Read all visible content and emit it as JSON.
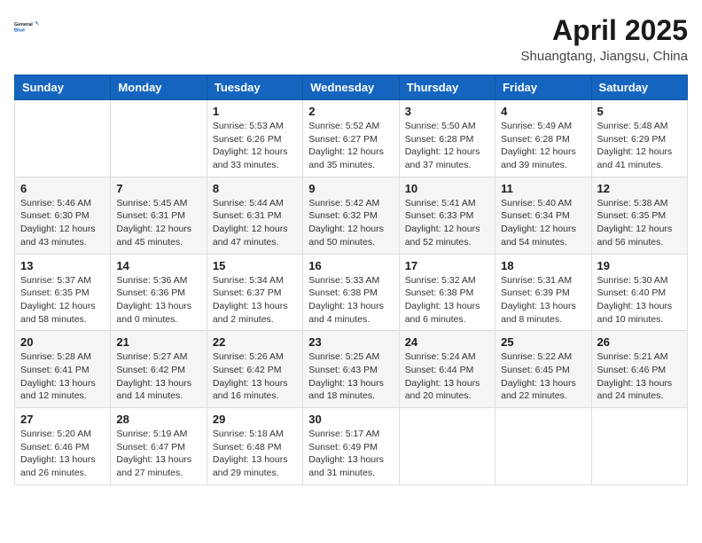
{
  "header": {
    "logo_line1": "General",
    "logo_line2": "Blue",
    "title": "April 2025",
    "subtitle": "Shuangtang, Jiangsu, China"
  },
  "weekdays": [
    "Sunday",
    "Monday",
    "Tuesday",
    "Wednesday",
    "Thursday",
    "Friday",
    "Saturday"
  ],
  "weeks": [
    [
      {
        "day": "",
        "sunrise": "",
        "sunset": "",
        "daylight": ""
      },
      {
        "day": "",
        "sunrise": "",
        "sunset": "",
        "daylight": ""
      },
      {
        "day": "1",
        "sunrise": "Sunrise: 5:53 AM",
        "sunset": "Sunset: 6:26 PM",
        "daylight": "Daylight: 12 hours and 33 minutes."
      },
      {
        "day": "2",
        "sunrise": "Sunrise: 5:52 AM",
        "sunset": "Sunset: 6:27 PM",
        "daylight": "Daylight: 12 hours and 35 minutes."
      },
      {
        "day": "3",
        "sunrise": "Sunrise: 5:50 AM",
        "sunset": "Sunset: 6:28 PM",
        "daylight": "Daylight: 12 hours and 37 minutes."
      },
      {
        "day": "4",
        "sunrise": "Sunrise: 5:49 AM",
        "sunset": "Sunset: 6:28 PM",
        "daylight": "Daylight: 12 hours and 39 minutes."
      },
      {
        "day": "5",
        "sunrise": "Sunrise: 5:48 AM",
        "sunset": "Sunset: 6:29 PM",
        "daylight": "Daylight: 12 hours and 41 minutes."
      }
    ],
    [
      {
        "day": "6",
        "sunrise": "Sunrise: 5:46 AM",
        "sunset": "Sunset: 6:30 PM",
        "daylight": "Daylight: 12 hours and 43 minutes."
      },
      {
        "day": "7",
        "sunrise": "Sunrise: 5:45 AM",
        "sunset": "Sunset: 6:31 PM",
        "daylight": "Daylight: 12 hours and 45 minutes."
      },
      {
        "day": "8",
        "sunrise": "Sunrise: 5:44 AM",
        "sunset": "Sunset: 6:31 PM",
        "daylight": "Daylight: 12 hours and 47 minutes."
      },
      {
        "day": "9",
        "sunrise": "Sunrise: 5:42 AM",
        "sunset": "Sunset: 6:32 PM",
        "daylight": "Daylight: 12 hours and 50 minutes."
      },
      {
        "day": "10",
        "sunrise": "Sunrise: 5:41 AM",
        "sunset": "Sunset: 6:33 PM",
        "daylight": "Daylight: 12 hours and 52 minutes."
      },
      {
        "day": "11",
        "sunrise": "Sunrise: 5:40 AM",
        "sunset": "Sunset: 6:34 PM",
        "daylight": "Daylight: 12 hours and 54 minutes."
      },
      {
        "day": "12",
        "sunrise": "Sunrise: 5:38 AM",
        "sunset": "Sunset: 6:35 PM",
        "daylight": "Daylight: 12 hours and 56 minutes."
      }
    ],
    [
      {
        "day": "13",
        "sunrise": "Sunrise: 5:37 AM",
        "sunset": "Sunset: 6:35 PM",
        "daylight": "Daylight: 12 hours and 58 minutes."
      },
      {
        "day": "14",
        "sunrise": "Sunrise: 5:36 AM",
        "sunset": "Sunset: 6:36 PM",
        "daylight": "Daylight: 13 hours and 0 minutes."
      },
      {
        "day": "15",
        "sunrise": "Sunrise: 5:34 AM",
        "sunset": "Sunset: 6:37 PM",
        "daylight": "Daylight: 13 hours and 2 minutes."
      },
      {
        "day": "16",
        "sunrise": "Sunrise: 5:33 AM",
        "sunset": "Sunset: 6:38 PM",
        "daylight": "Daylight: 13 hours and 4 minutes."
      },
      {
        "day": "17",
        "sunrise": "Sunrise: 5:32 AM",
        "sunset": "Sunset: 6:38 PM",
        "daylight": "Daylight: 13 hours and 6 minutes."
      },
      {
        "day": "18",
        "sunrise": "Sunrise: 5:31 AM",
        "sunset": "Sunset: 6:39 PM",
        "daylight": "Daylight: 13 hours and 8 minutes."
      },
      {
        "day": "19",
        "sunrise": "Sunrise: 5:30 AM",
        "sunset": "Sunset: 6:40 PM",
        "daylight": "Daylight: 13 hours and 10 minutes."
      }
    ],
    [
      {
        "day": "20",
        "sunrise": "Sunrise: 5:28 AM",
        "sunset": "Sunset: 6:41 PM",
        "daylight": "Daylight: 13 hours and 12 minutes."
      },
      {
        "day": "21",
        "sunrise": "Sunrise: 5:27 AM",
        "sunset": "Sunset: 6:42 PM",
        "daylight": "Daylight: 13 hours and 14 minutes."
      },
      {
        "day": "22",
        "sunrise": "Sunrise: 5:26 AM",
        "sunset": "Sunset: 6:42 PM",
        "daylight": "Daylight: 13 hours and 16 minutes."
      },
      {
        "day": "23",
        "sunrise": "Sunrise: 5:25 AM",
        "sunset": "Sunset: 6:43 PM",
        "daylight": "Daylight: 13 hours and 18 minutes."
      },
      {
        "day": "24",
        "sunrise": "Sunrise: 5:24 AM",
        "sunset": "Sunset: 6:44 PM",
        "daylight": "Daylight: 13 hours and 20 minutes."
      },
      {
        "day": "25",
        "sunrise": "Sunrise: 5:22 AM",
        "sunset": "Sunset: 6:45 PM",
        "daylight": "Daylight: 13 hours and 22 minutes."
      },
      {
        "day": "26",
        "sunrise": "Sunrise: 5:21 AM",
        "sunset": "Sunset: 6:46 PM",
        "daylight": "Daylight: 13 hours and 24 minutes."
      }
    ],
    [
      {
        "day": "27",
        "sunrise": "Sunrise: 5:20 AM",
        "sunset": "Sunset: 6:46 PM",
        "daylight": "Daylight: 13 hours and 26 minutes."
      },
      {
        "day": "28",
        "sunrise": "Sunrise: 5:19 AM",
        "sunset": "Sunset: 6:47 PM",
        "daylight": "Daylight: 13 hours and 27 minutes."
      },
      {
        "day": "29",
        "sunrise": "Sunrise: 5:18 AM",
        "sunset": "Sunset: 6:48 PM",
        "daylight": "Daylight: 13 hours and 29 minutes."
      },
      {
        "day": "30",
        "sunrise": "Sunrise: 5:17 AM",
        "sunset": "Sunset: 6:49 PM",
        "daylight": "Daylight: 13 hours and 31 minutes."
      },
      {
        "day": "",
        "sunrise": "",
        "sunset": "",
        "daylight": ""
      },
      {
        "day": "",
        "sunrise": "",
        "sunset": "",
        "daylight": ""
      },
      {
        "day": "",
        "sunrise": "",
        "sunset": "",
        "daylight": ""
      }
    ]
  ]
}
